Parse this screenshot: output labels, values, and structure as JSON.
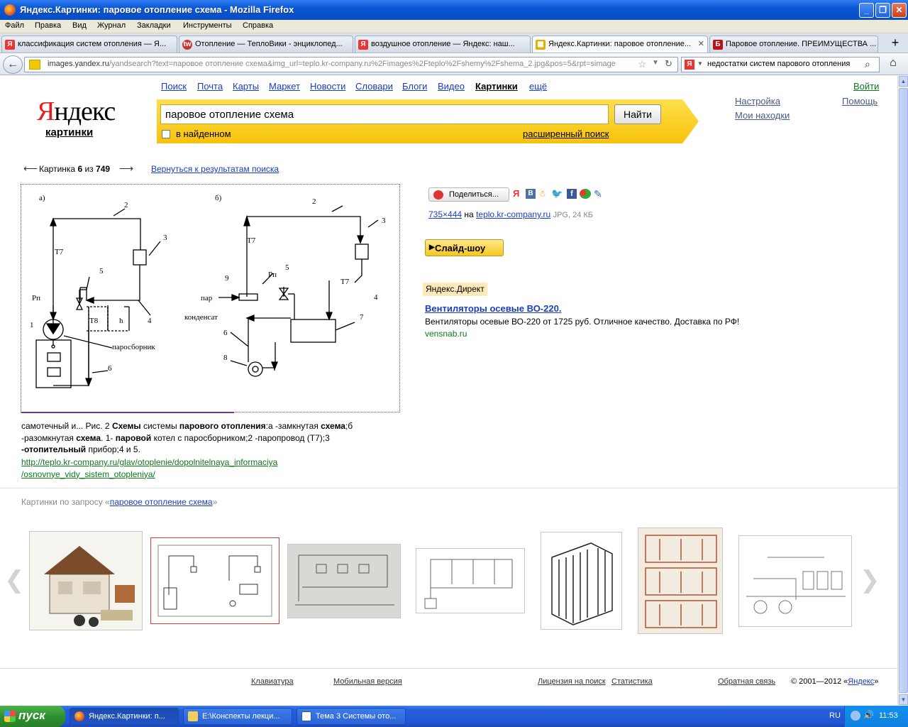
{
  "window": {
    "title": "Яндекс.Картинки: паровое отопление схема - Mozilla Firefox"
  },
  "menu": [
    "Файл",
    "Правка",
    "Вид",
    "Журнал",
    "Закладки",
    "Инструменты",
    "Справка"
  ],
  "tabs": [
    {
      "label": "классификация систем отопления — Я...",
      "fav": "Я",
      "color": "#e33"
    },
    {
      "label": "Отопление — ТеплоВики - энциклопед...",
      "fav": "tw",
      "color": "#c33"
    },
    {
      "label": "воздушное отопление — Яндекс: наш...",
      "fav": "Я",
      "color": "#e33"
    },
    {
      "label": "Яндекс.Картинки: паровое отопление...",
      "fav": "▦",
      "color": "#e0b000"
    },
    {
      "label": "Паровое отопление. ПРЕИМУЩЕСТВА ...",
      "fav": "Б",
      "color": "#b11"
    }
  ],
  "nav": {
    "url_host": "images.yandex.ru",
    "url_rest": "/yandsearch?text=паровое отопление схема&img_url=teplo.kr-company.ru%2Fimages%2Fteplo%2Fshemy%2Fshema_2.jpg&pos=5&rpt=simage",
    "search_text": "недостатки систем парового отопления"
  },
  "services": [
    "Поиск",
    "Почта",
    "Карты",
    "Маркет",
    "Новости",
    "Словари",
    "Блоги",
    "Видео",
    "Картинки",
    "ещё"
  ],
  "login": "Войти",
  "settings": "Настройка",
  "help": "Помощь",
  "my_finds": "Мои находки",
  "logo": {
    "y": "Я",
    "rest": "ндекс",
    "sub": "картинки"
  },
  "search": {
    "query": "паровое отопление схема",
    "button": "Найти",
    "in_found": "в найденном",
    "advanced": "расширенный поиск"
  },
  "pager": {
    "prefix": "Картинка",
    "current": "6",
    "of": "из",
    "total": "749",
    "back": "Вернуться к результатам поиска"
  },
  "diagram": {
    "a": "а)",
    "b": "б)",
    "T7": "Т7",
    "T8": "Т8",
    "Pn": "Рп",
    "h": "h",
    "parosbornik": "паросборник",
    "par": "пар",
    "kondensat": "конденсат",
    "n1": "1",
    "n2": "2",
    "n3": "3",
    "n4": "4",
    "n5": "5",
    "n6": "6",
    "n7": "7",
    "n8": "8",
    "n9": "9"
  },
  "caption": {
    "l1a": "самотечный и... Рис. 2 ",
    "l1b": "Схемы",
    "l1c": " системы ",
    "l1d": "парового отопления",
    ":": "",
    "l1e": ":а -замкнутая ",
    "l1f": "схема",
    "l1g": ";б",
    "l2a": "-разомкнутая ",
    "l2b": "схема",
    "l2c": ". 1- ",
    "l2d": "паровой",
    "l2e": " котел с паросборником;2 -паропровод (Т7);3",
    "l3a": "-отопительный",
    "l3b": " прибор;4 и 5.",
    "url1": "http://teplo.kr-company.ru/glav/otoplenie/dopolnitelnaya_informaciya",
    "url2": "/osnovnye_vidy_sistem_otopleniya/"
  },
  "share": {
    "label": "Поделиться..."
  },
  "meta": {
    "size": "735×444",
    "on": "на",
    "site": "teplo.kr-company.ru",
    "fmt": "JPG, 24 КБ"
  },
  "slideshow": "Слайд-шоу",
  "direct": {
    "label": "Яндекс.Директ",
    "title": "Вентиляторы осевые ВО-220.",
    "text": "Вентиляторы осевые ВО-220 от 1725 руб. Отличное качество. Доставка по РФ!",
    "domain": "vensnab.ru"
  },
  "related": {
    "prefix": "Картинки по запросу «",
    "query": "паровое отопление схема",
    "suffix": "»"
  },
  "footer": {
    "keyboard": "Клавиатура",
    "mobile": "Мобильная версия",
    "license": "Лицензия на поиск",
    "stats": "Статистика",
    "feedback": "Обратная связь",
    "copy": "© 2001—2012 «",
    "yandex": "Яндекс",
    "copy_end": "»"
  },
  "taskbar": {
    "start": "пуск",
    "tasks": [
      "Яндекс.Картинки: п...",
      "E:\\Конспекты лекци...",
      "Тема 3 Системы ото..."
    ],
    "lang": "RU",
    "time": "11:53"
  }
}
